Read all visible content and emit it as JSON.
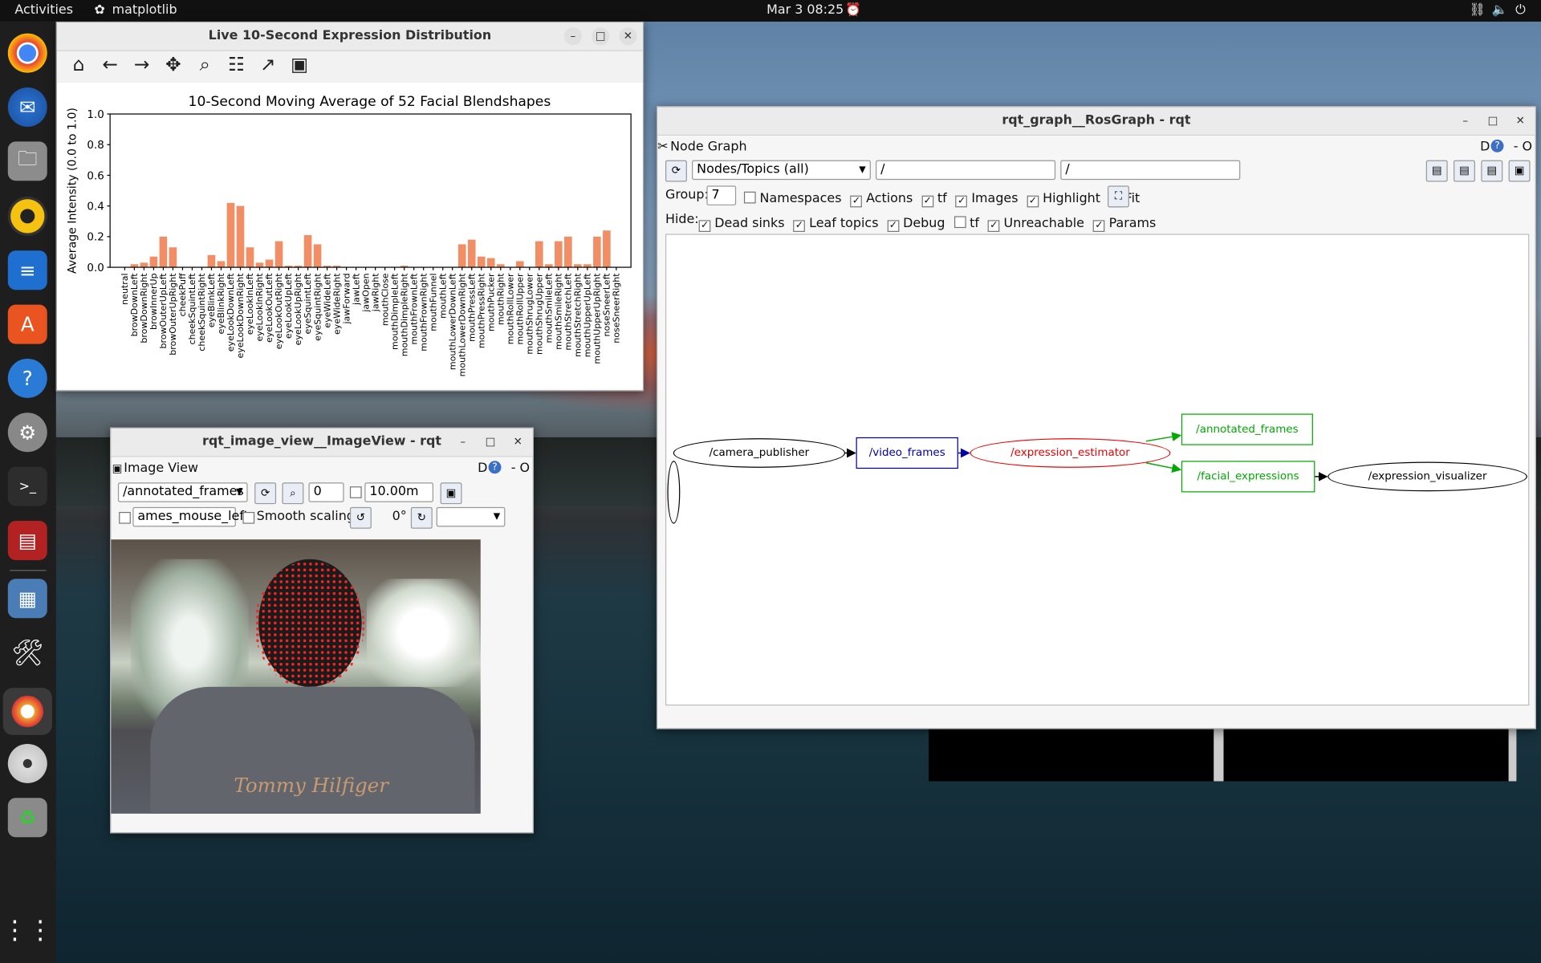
{
  "topbar": {
    "activities": "Activities",
    "app_name": "matplotlib",
    "datetime": "Mar 3  08:25"
  },
  "dock": {
    "apps": [
      "chrome-icon",
      "thunderbird-icon",
      "files-icon",
      "rhythmbox-icon",
      "writer-icon",
      "app-center-icon",
      "help-icon",
      "settings-icon",
      "terminal-icon",
      "app-red-icon",
      "image-viewer-icon",
      "tools-icon",
      "rqt-icon",
      "dvd-icon",
      "trash-icon",
      "app-grid-icon"
    ]
  },
  "matplotlib_window": {
    "title": "Live 10-Second Expression Distribution",
    "toolbar": [
      "home-icon",
      "back-icon",
      "forward-icon",
      "pan-icon",
      "zoom-icon",
      "configure-icon",
      "edit-icon",
      "save-icon"
    ]
  },
  "chart_data": {
    "type": "bar",
    "title": "10-Second Moving Average of 52 Facial Blendshapes",
    "xlabel": "",
    "ylabel": "Average Intensity (0.0 to 1.0)",
    "ylim": [
      0,
      1.0
    ],
    "yticks": [
      "0.0",
      "0.2",
      "0.4",
      "0.6",
      "0.8",
      "1.0"
    ],
    "color": "#f28e65",
    "categories": [
      "neutral",
      "browDownLeft",
      "browDownRight",
      "browInnerUp",
      "browOuterUpLeft",
      "browOuterUpRight",
      "cheekPuff",
      "cheekSquintLeft",
      "cheekSquintRight",
      "eyeBlinkLeft",
      "eyeBlinkRight",
      "eyeLookDownLeft",
      "eyeLookDownRight",
      "eyeLookInLeft",
      "eyeLookInRight",
      "eyeLookOutLeft",
      "eyeLookOutRight",
      "eyeLookUpLeft",
      "eyeLookUpRight",
      "eyeSquintLeft",
      "eyeSquintRight",
      "eyeWideLeft",
      "eyeWideRight",
      "jawForward",
      "jawLeft",
      "jawOpen",
      "jawRight",
      "mouthClose",
      "mouthDimpleLeft",
      "mouthDimpleRight",
      "mouthFrownLeft",
      "mouthFrownRight",
      "mouthFunnel",
      "mouthLeft",
      "mouthLowerDownLeft",
      "mouthLowerDownRight",
      "mouthPressLeft",
      "mouthPressRight",
      "mouthPucker",
      "mouthRight",
      "mouthRollLower",
      "mouthRollUpper",
      "mouthShrugLower",
      "mouthShrugUpper",
      "mouthSmileLeft",
      "mouthSmileRight",
      "mouthStretchLeft",
      "mouthStretchRight",
      "mouthUpperUpLeft",
      "mouthUpperUpRight",
      "noseSneerLeft",
      "noseSneerRight"
    ],
    "values": [
      0.0,
      0.02,
      0.03,
      0.07,
      0.2,
      0.13,
      0.0,
      0.0,
      0.0,
      0.08,
      0.04,
      0.42,
      0.4,
      0.13,
      0.03,
      0.05,
      0.17,
      0.01,
      0.01,
      0.21,
      0.15,
      0.01,
      0.01,
      0.0,
      0.0,
      0.0,
      0.0,
      0.0,
      0.0,
      0.01,
      0.0,
      0.0,
      0.0,
      0.0,
      0.0,
      0.15,
      0.18,
      0.07,
      0.06,
      0.02,
      0.0,
      0.04,
      0.0,
      0.17,
      0.02,
      0.17,
      0.2,
      0.02,
      0.02,
      0.2,
      0.24,
      0.0
    ]
  },
  "rosgraph_window": {
    "title": "rqt_graph__RosGraph - rqt",
    "plugin_title": "Node Graph",
    "dock_btns": "D",
    "dock_close": "- O",
    "mode_select": "Nodes/Topics (all)",
    "filter1": "/",
    "filter2": "/",
    "group_label": "Group:",
    "group_value": "7",
    "row1_checks": [
      {
        "label": "Namespaces",
        "checked": false,
        "symbol": ""
      },
      {
        "label": "Actions",
        "checked": true,
        "symbol": "✓"
      },
      {
        "label": "tf",
        "checked": true,
        "symbol": "✓"
      },
      {
        "label": "Images",
        "checked": true,
        "symbol": "✓"
      },
      {
        "label": "Highlight",
        "checked": true,
        "symbol": "✓"
      },
      {
        "label": "Fit",
        "checked": true,
        "symbol": "✓"
      }
    ],
    "hide_label": "Hide:",
    "hide_checks": [
      {
        "label": "Dead sinks",
        "symbol": "✓"
      },
      {
        "label": "Leaf topics",
        "symbol": "✓"
      },
      {
        "label": "Debug",
        "symbol": "✓"
      },
      {
        "label": "tf",
        "symbol": ""
      },
      {
        "label": "Unreachable",
        "symbol": "✓"
      },
      {
        "label": "Params",
        "symbol": "✓"
      }
    ],
    "nodes": {
      "camera_publisher": "/camera_publisher",
      "video_frames": "/video_frames",
      "expression_estimator": "/expression_estimator",
      "annotated_frames": "/annotated_frames",
      "facial_expressions": "/facial_expressions",
      "expression_visualizer": "/expression_visualizer"
    }
  },
  "imageview_window": {
    "title": "rqt_image_view__ImageView - rqt",
    "plugin_title": "Image View",
    "dock_btns": "D",
    "dock_close": "- O",
    "topic": "/annotated_frames",
    "num_value": "0",
    "time_value": "10.00m",
    "mouse_topic": "ames_mouse_left",
    "smooth_label": "Smooth scaling",
    "rotation": "0°",
    "shirt_text": "Tommy Hilfiger"
  }
}
